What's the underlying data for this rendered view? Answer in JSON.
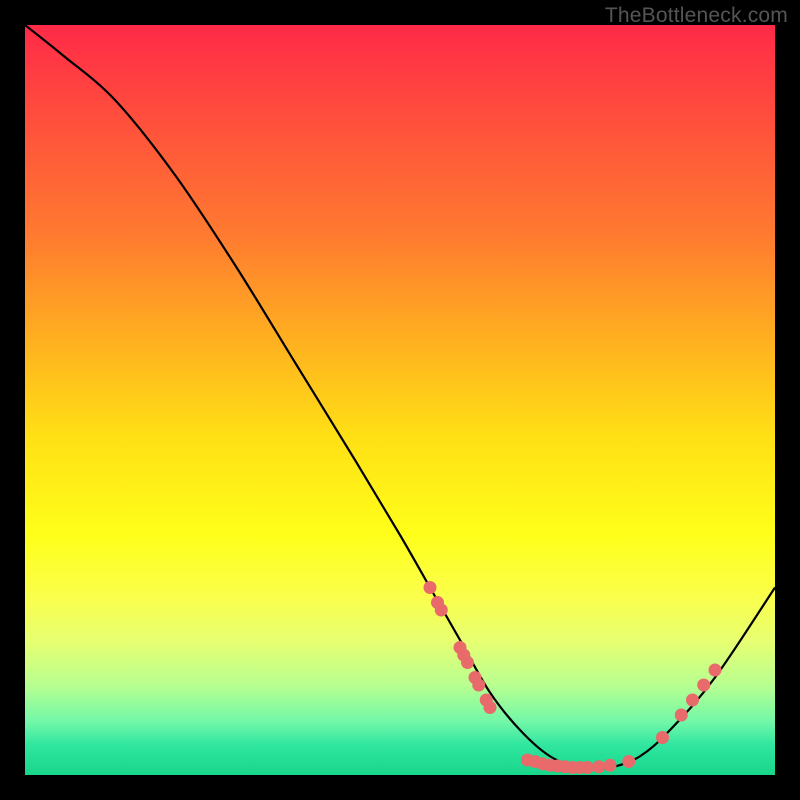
{
  "watermark": "TheBottleneck.com",
  "chart_data": {
    "type": "line",
    "title": "",
    "xlabel": "",
    "ylabel": "",
    "xlim": [
      0,
      100
    ],
    "ylim": [
      0,
      100
    ],
    "series": [
      {
        "name": "curve",
        "x": [
          0,
          5,
          12,
          20,
          28,
          36,
          44,
          50,
          54,
          58,
          62,
          66,
          70,
          74,
          78,
          82,
          86,
          92,
          100
        ],
        "y": [
          100,
          96,
          90,
          80,
          68,
          55,
          42,
          32,
          25,
          18,
          11,
          6,
          2.5,
          1,
          1,
          2.5,
          6,
          13,
          25
        ]
      }
    ],
    "markers": [
      {
        "x": 54,
        "y": 25,
        "r": 1.0
      },
      {
        "x": 55,
        "y": 23,
        "r": 1.0
      },
      {
        "x": 55.5,
        "y": 22,
        "r": 1.0
      },
      {
        "x": 58,
        "y": 17,
        "r": 1.0
      },
      {
        "x": 58.5,
        "y": 16,
        "r": 1.0
      },
      {
        "x": 59,
        "y": 15,
        "r": 1.0
      },
      {
        "x": 60,
        "y": 13,
        "r": 1.0
      },
      {
        "x": 60.5,
        "y": 12,
        "r": 1.0
      },
      {
        "x": 61.5,
        "y": 10,
        "r": 1.0
      },
      {
        "x": 62,
        "y": 9,
        "r": 1.0
      },
      {
        "x": 67,
        "y": 2,
        "r": 1.0
      },
      {
        "x": 68,
        "y": 1.8,
        "r": 1.0
      },
      {
        "x": 69,
        "y": 1.5,
        "r": 1.0
      },
      {
        "x": 70,
        "y": 1.3,
        "r": 1.0
      },
      {
        "x": 71,
        "y": 1.2,
        "r": 1.0
      },
      {
        "x": 72,
        "y": 1.1,
        "r": 1.0
      },
      {
        "x": 73,
        "y": 1.0,
        "r": 1.0
      },
      {
        "x": 74,
        "y": 1.0,
        "r": 1.0
      },
      {
        "x": 75,
        "y": 1.0,
        "r": 1.0
      },
      {
        "x": 76.5,
        "y": 1.1,
        "r": 1.0
      },
      {
        "x": 78,
        "y": 1.3,
        "r": 1.0
      },
      {
        "x": 80.5,
        "y": 1.8,
        "r": 1.0
      },
      {
        "x": 85,
        "y": 5,
        "r": 1.0
      },
      {
        "x": 87.5,
        "y": 8,
        "r": 1.0
      },
      {
        "x": 89,
        "y": 10,
        "r": 1.0
      },
      {
        "x": 90.5,
        "y": 12,
        "r": 1.0
      },
      {
        "x": 92,
        "y": 14,
        "r": 1.0
      }
    ],
    "marker_color": "#e86a6a",
    "curve_color": "#000000"
  }
}
